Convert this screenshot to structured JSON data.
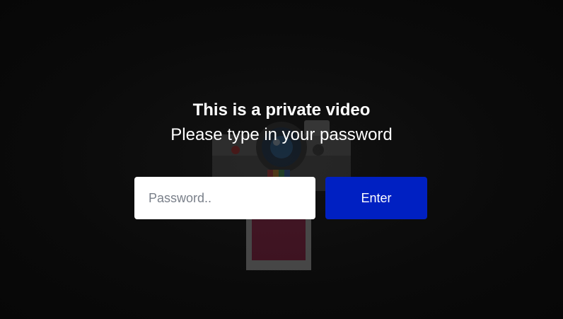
{
  "overlay": {
    "title": "This is a private video",
    "subtitle": "Please type in your password"
  },
  "form": {
    "password_placeholder": "Password..",
    "password_value": "",
    "enter_label": "Enter"
  },
  "background": {
    "illustration": "instant-camera-icon"
  },
  "colors": {
    "page_background": "#0b0b0b",
    "button_background": "#0020c2",
    "input_background": "#ffffff",
    "text": "#ffffff"
  }
}
